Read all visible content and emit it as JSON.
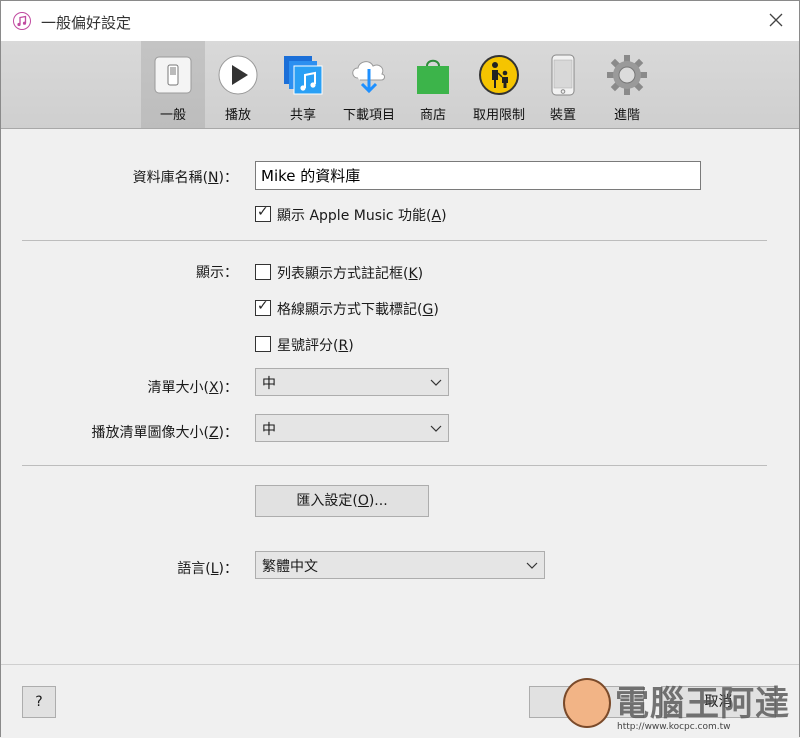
{
  "window": {
    "title": "一般偏好設定"
  },
  "toolbar": {
    "items": [
      {
        "label": "一般",
        "icon": "general-switch-icon"
      },
      {
        "label": "播放",
        "icon": "play-icon"
      },
      {
        "label": "共享",
        "icon": "share-music-icon"
      },
      {
        "label": "下載項目",
        "icon": "cloud-download-icon"
      },
      {
        "label": "商店",
        "icon": "store-bag-icon"
      },
      {
        "label": "取用限制",
        "icon": "parental-restrictions-icon"
      },
      {
        "label": "裝置",
        "icon": "device-phone-icon"
      },
      {
        "label": "進階",
        "icon": "advanced-gear-icon"
      }
    ],
    "active_index": 0
  },
  "library_name": {
    "label_prefix": "資料庫名稱(",
    "label_key": "N",
    "label_suffix": ")：",
    "value": "Mike 的資料庫"
  },
  "apple_music": {
    "text_prefix": "顯示 Apple Music 功能(",
    "key": "A",
    "text_suffix": ")",
    "checked": true
  },
  "display": {
    "label": "顯示：",
    "options": [
      {
        "text_prefix": "列表顯示方式註記框(",
        "key": "K",
        "text_suffix": ")",
        "checked": false
      },
      {
        "text_prefix": "格線顯示方式下載標記(",
        "key": "G",
        "text_suffix": ")",
        "checked": true
      },
      {
        "text_prefix": "星號評分(",
        "key": "R",
        "text_suffix": ")",
        "checked": false
      }
    ]
  },
  "list_size": {
    "label_prefix": "清單大小(",
    "key": "X",
    "label_suffix": ")：",
    "value": "中"
  },
  "artwork_size": {
    "label_prefix": "播放清單圖像大小(",
    "key": "Z",
    "label_suffix": ")：",
    "value": "中"
  },
  "import_button": {
    "prefix": "匯入設定(",
    "key": "O",
    "suffix": ")..."
  },
  "language": {
    "label_prefix": "語言(",
    "key": "L",
    "label_suffix": ")：",
    "value": "繁體中文"
  },
  "footer": {
    "help": "?",
    "ok": "確定",
    "cancel": "取消"
  },
  "watermark": {
    "text": "電腦王阿達",
    "url": "http://www.kocpc.com.tw"
  },
  "colors": {
    "accent_blue": "#1e90ff",
    "store_green": "#3cb44a",
    "restrict_yellow": "#f5c400"
  }
}
